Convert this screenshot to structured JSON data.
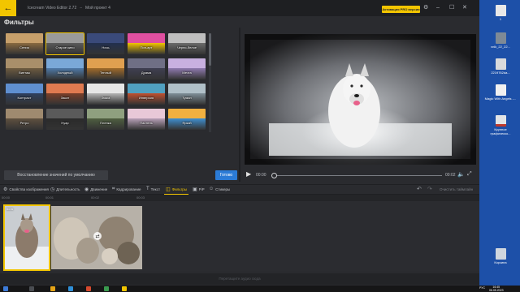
{
  "window": {
    "app_title": "Icecream Video Editor 2.72",
    "separator": "–",
    "project_name": "Мой проект 4",
    "pro_button": "Активация PRO версии"
  },
  "page_title": "Фильтры",
  "filters": [
    {
      "label": "Сепия"
    },
    {
      "label": "Старое кино"
    },
    {
      "label": "Ночь"
    },
    {
      "label": "Поп-арт"
    },
    {
      "label": "Черно-белое"
    },
    {
      "label": "Винтаж"
    },
    {
      "label": "Холодный"
    },
    {
      "label": "Теплый"
    },
    {
      "label": "Драма"
    },
    {
      "label": "Мечта"
    },
    {
      "label": "Контраст"
    },
    {
      "label": "Закат"
    },
    {
      "label": "Эскиз"
    },
    {
      "label": "Инверсия"
    },
    {
      "label": "Туман"
    },
    {
      "label": "Ретро"
    },
    {
      "label": "Нуар"
    },
    {
      "label": "Пленка"
    },
    {
      "label": "Пастель"
    },
    {
      "label": "Яркий"
    }
  ],
  "buttons": {
    "reset": "Восстановление значений по умолчанию",
    "done": "Готово"
  },
  "player": {
    "time_current": "00:00",
    "time_end": "00:02",
    "progress": 0
  },
  "toolbar": {
    "items": [
      {
        "label": "Свойства изображения"
      },
      {
        "label": "Длительность"
      },
      {
        "label": "Движение"
      },
      {
        "label": "Кадрирование"
      },
      {
        "label": "Текст"
      },
      {
        "label": "Фильтры"
      },
      {
        "label": "PiP"
      },
      {
        "label": "Стикеры"
      }
    ],
    "active": "Фильтры",
    "clear": "Очистить таймлайн"
  },
  "ruler": [
    "00:00",
    "00:01",
    "00:02",
    "00:03"
  ],
  "timeline": {
    "clip1_name": "волк",
    "audio_hint": "Перетащите аудио сюда"
  },
  "desktop": {
    "icons": [
      {
        "label": "1"
      },
      {
        "label": "vnlk_22_22..."
      },
      {
        "label": "2219762da..."
      },
      {
        "label": "Magic With Angels -..."
      },
      {
        "label": "Крупное графическо..."
      },
      {
        "label": "Корзина"
      }
    ],
    "clock_time": "16:45",
    "clock_date": "06.05.2023",
    "lang": "РУС"
  },
  "colors": {
    "accent": "#f2c500",
    "primary_button": "#2b7bd6",
    "desktop_bg": "#1d50a8"
  }
}
